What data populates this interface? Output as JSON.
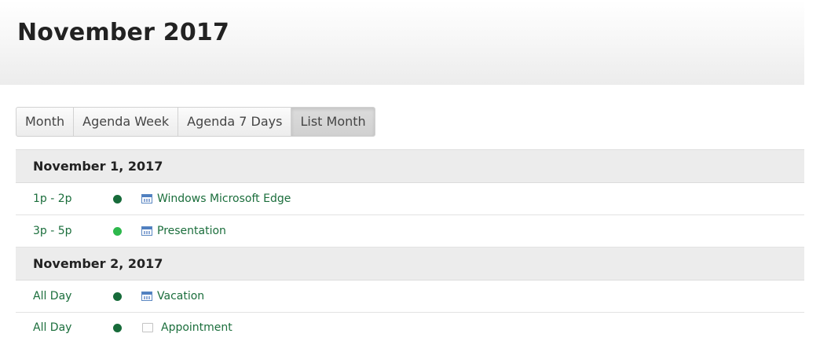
{
  "calendar": {
    "title": "November 2017"
  },
  "view_tabs": [
    {
      "label": "Month",
      "active": false
    },
    {
      "label": "Agenda Week",
      "active": false
    },
    {
      "label": "Agenda 7 Days",
      "active": false
    },
    {
      "label": "List Month",
      "active": true
    }
  ],
  "days": [
    {
      "date": "November 1, 2017",
      "events": [
        {
          "time": "1p - 2p",
          "dot_color": "#176b3a",
          "icon": "calendar-icon",
          "title": "Windows Microsoft Edge"
        },
        {
          "time": "3p - 5p",
          "dot_color": "#2db84c",
          "icon": "calendar-icon",
          "title": "Presentation"
        }
      ]
    },
    {
      "date": "November 2, 2017",
      "events": [
        {
          "time": "All Day",
          "dot_color": "#176b3a",
          "icon": "calendar-icon",
          "title": "Vacation"
        },
        {
          "time": "All Day",
          "dot_color": "#176b3a",
          "icon": "checkbox-icon",
          "title": "Appointment"
        }
      ]
    }
  ],
  "colors": {
    "event_text": "#1b6e3c",
    "day_header_bg": "#ececec",
    "title_text": "#222222"
  }
}
